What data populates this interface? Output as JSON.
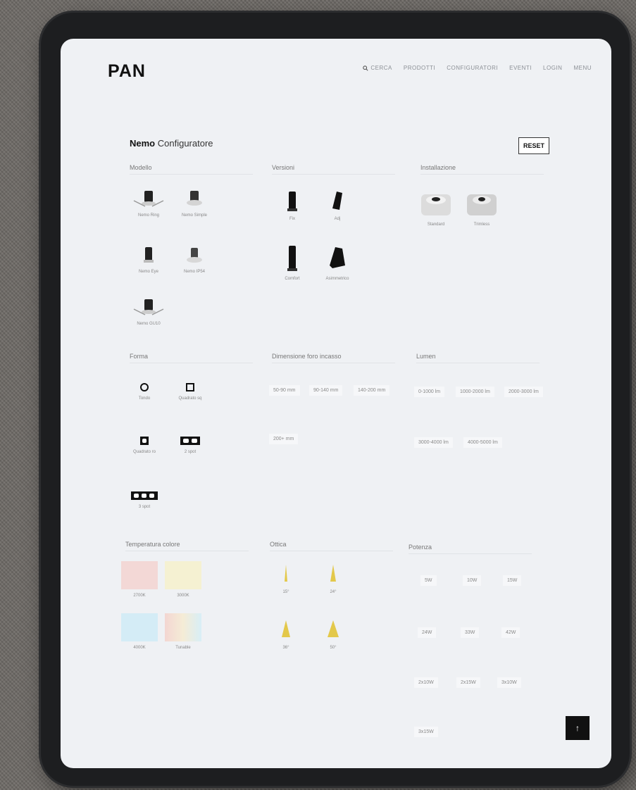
{
  "brand": {
    "logo": "PAN"
  },
  "nav": {
    "search": "CERCA",
    "items": [
      "PRODOTTI",
      "CONFIGURATORI",
      "EVENTI",
      "LOGIN",
      "MENU"
    ]
  },
  "configurator": {
    "title_bold": "Nemo",
    "title_rest": " Configuratore",
    "reset_label": "RESET"
  },
  "sections": {
    "modello": {
      "title": "Modello",
      "options": [
        "Nemo Ring",
        "Nemo Simple",
        "Nemo Eye",
        "Nemo IP54",
        "Nemo GU10"
      ]
    },
    "versioni": {
      "title": "Versioni",
      "options": [
        "Fix",
        "Adj",
        "Comfort",
        "Asimmetrico"
      ]
    },
    "installazione": {
      "title": "Installazione",
      "options": [
        "Standard",
        "Trimless"
      ]
    },
    "forma": {
      "title": "Forma",
      "options": [
        "Tondo",
        "Quadrato sq",
        "Quadrato ro",
        "2 spot",
        "3 spot"
      ]
    },
    "dimensione": {
      "title": "Dimensione foro incasso",
      "options": [
        "50-90 mm",
        "90-140 mm",
        "140-200 mm",
        "200+ mm"
      ]
    },
    "lumen": {
      "title": "Lumen",
      "options": [
        "0-1000 lm",
        "1000-2000 lm",
        "2000-3000 lm",
        "3000-4000 lm",
        "4000-5000 lm"
      ]
    },
    "temperatura": {
      "title": "Temperatura colore",
      "options": [
        {
          "label": "2700K",
          "color": "#f3d8d6"
        },
        {
          "label": "3000K",
          "color": "#f5f1d2"
        },
        {
          "label": "4000K",
          "color": "#d4ecf6"
        },
        {
          "label": "Tunable",
          "color": "#f2e6e2"
        }
      ]
    },
    "ottica": {
      "title": "Ottica",
      "options": [
        "15°",
        "24°",
        "36°",
        "50°"
      ]
    },
    "potenza": {
      "title": "Potenza",
      "options": [
        "5W",
        "10W",
        "15W",
        "24W",
        "33W",
        "42W",
        "2x10W",
        "2x15W",
        "3x10W",
        "3x15W"
      ]
    }
  },
  "scroll_top": {
    "label": "↑"
  }
}
